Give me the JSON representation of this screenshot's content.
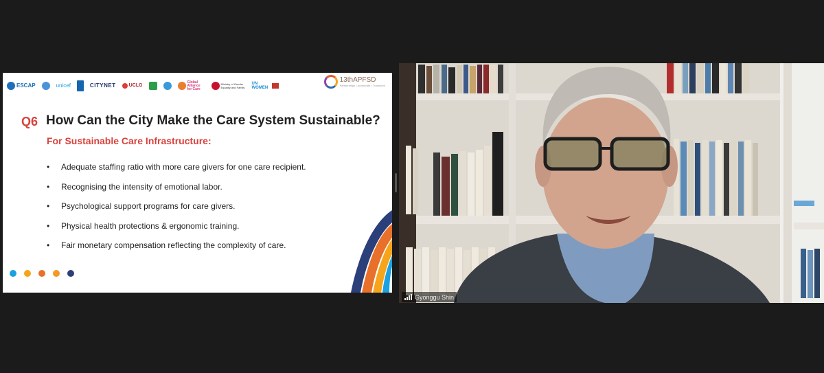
{
  "slide": {
    "logos": [
      {
        "name": "escap",
        "text": "ESCAP"
      },
      {
        "name": "un",
        "text": ""
      },
      {
        "name": "unicef",
        "text": "unicef"
      },
      {
        "name": "undp",
        "text": ""
      },
      {
        "name": "citynet",
        "text": "CITYNET"
      },
      {
        "name": "uclg",
        "text": "UCLG"
      },
      {
        "name": "org7",
        "text": ""
      },
      {
        "name": "org8",
        "text": ""
      },
      {
        "name": "global-alliance",
        "text": "Global Alliance for Care"
      },
      {
        "name": "korea-ministry",
        "text": "Ministry of Gender Equality and Family"
      },
      {
        "name": "unwomen",
        "text": "UN WOMEN"
      },
      {
        "name": "org12",
        "text": ""
      }
    ],
    "apfsd_label": "13thAPFSD",
    "apfsd_tagline": "Partnerships • Accelerate • Transform",
    "question_number": "Q6",
    "title": "How Can the City Make the Care System Sustainable?",
    "subtitle": "For Sustainable Care Infrastructure:",
    "bullet_symbol": "•",
    "bullets": [
      "Adequate staffing ratio with more care givers for one care recipient.",
      "Recognising the intensity of emotional labor.",
      "Psychological support programs for care givers.",
      "Physical health protections & ergonomic training.",
      "Fair monetary compensation reflecting the complexity of care."
    ],
    "dot_colors": [
      "#1ba1e2",
      "#f6a41c",
      "#e8702a",
      "#f39a24",
      "#2b3f7a"
    ]
  },
  "participant": {
    "name": "Gyonggu Shin"
  }
}
